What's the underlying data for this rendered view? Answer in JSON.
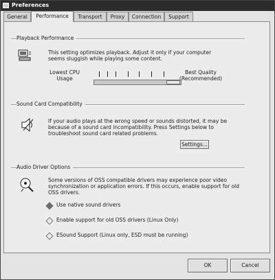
{
  "window": {
    "title": "Preferences"
  },
  "tabs": [
    {
      "label": "General",
      "active": false
    },
    {
      "label": "Performance",
      "active": true
    },
    {
      "label": "Transport",
      "active": false
    },
    {
      "label": "Proxy",
      "active": false
    },
    {
      "label": "Connection",
      "active": false
    },
    {
      "label": "Support",
      "active": false
    }
  ],
  "playback": {
    "title": "Playback Performance",
    "description": "This setting optimizes playback. Adjust it only if your computer seems sluggish while playing some content.",
    "slider_left_label": "Lowest CPU Usage",
    "slider_right_label": "Best Quality (Recommended)",
    "slider_value": 1.0
  },
  "soundcard": {
    "title": "Sound Card Compatibility",
    "description": "If your audio plays at the wrong speed or sounds distorted, it may be because of a sound card incompatibility. Press Settings below to troubleshoot sound card related problems.",
    "settings_button": "Settings..."
  },
  "audio_driver": {
    "title": "Audio Driver Options",
    "description": "Some versions of OSS compatible drivers may experience poor video synchronization or application errors. If this occurs, enable support for old OSS drivers.",
    "options": [
      {
        "label": "Use native sound drivers",
        "selected": true
      },
      {
        "label": "Enable support for old OSS drivers (Linux Only)",
        "selected": false
      },
      {
        "label": "ESound Support (Linux only, ESD must be running)",
        "selected": false
      }
    ]
  },
  "footer": {
    "ok": "OK",
    "cancel": "Cancel"
  },
  "colors": {
    "titlebar": "#2c2c2c",
    "panel": "#ececec",
    "border": "#8a8a8a"
  }
}
